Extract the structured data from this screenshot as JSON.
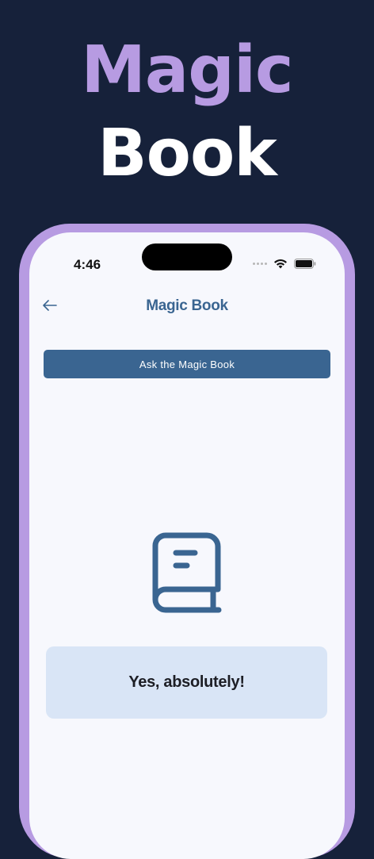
{
  "promo": {
    "title_line1": "Magic",
    "title_line2": "Book"
  },
  "status_bar": {
    "time": "4:46",
    "icons": [
      "signal-dots-icon",
      "wifi-icon",
      "battery-icon"
    ]
  },
  "nav": {
    "back_icon": "arrow-left-icon",
    "title": "Magic Book"
  },
  "main": {
    "ask_button_label": "Ask the Magic Book",
    "book_icon": "book-icon",
    "answer": "Yes, absolutely!"
  },
  "colors": {
    "background": "#16213a",
    "accent_purple": "#b79be2",
    "primary_blue": "#3a6591",
    "screen_bg": "#f7f8fd",
    "answer_bg": "#d9e5f6"
  }
}
